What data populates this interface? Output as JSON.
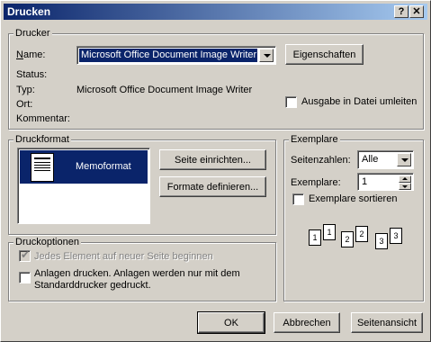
{
  "window": {
    "title": "Drucken",
    "help_glyph": "?",
    "close_glyph": "✕"
  },
  "printer": {
    "group_label": "Drucker",
    "name_label": "Name:",
    "name_value": "Microsoft Office Document Image Writer",
    "properties_button": "Eigenschaften",
    "status_label": "Status:",
    "status_value": "",
    "type_label": "Typ:",
    "type_value": "Microsoft Office Document Image Writer",
    "location_label": "Ort:",
    "location_value": "",
    "comment_label": "Kommentar:",
    "comment_value": "",
    "print_to_file_label": "Ausgabe in Datei umleiten",
    "print_to_file_checked": false
  },
  "print_format": {
    "group_label": "Druckformat",
    "selected_format": "Memoformat",
    "page_setup_button": "Seite einrichten...",
    "define_styles_button": "Formate definieren..."
  },
  "copies": {
    "group_label": "Exemplare",
    "page_range_label": "Seitenzahlen:",
    "page_range_value": "Alle",
    "copies_label": "Exemplare:",
    "copies_value": "1",
    "collate_label": "Exemplare sortieren",
    "collate_checked": false,
    "collate_icons": [
      "1",
      "1",
      "2",
      "2",
      "3",
      "3"
    ]
  },
  "print_options": {
    "group_label": "Druckoptionen",
    "new_page_label": "Jedes Element auf neuer Seite beginnen",
    "new_page_checked": true,
    "new_page_enabled": false,
    "attachments_label_line1": "Anlagen drucken. Anlagen werden nur mit dem",
    "attachments_label_line2": "Standarddrucker gedruckt.",
    "attachments_checked": false
  },
  "footer": {
    "ok_button": "OK",
    "cancel_button": "Abbrechen",
    "preview_button": "Seitenansicht"
  }
}
